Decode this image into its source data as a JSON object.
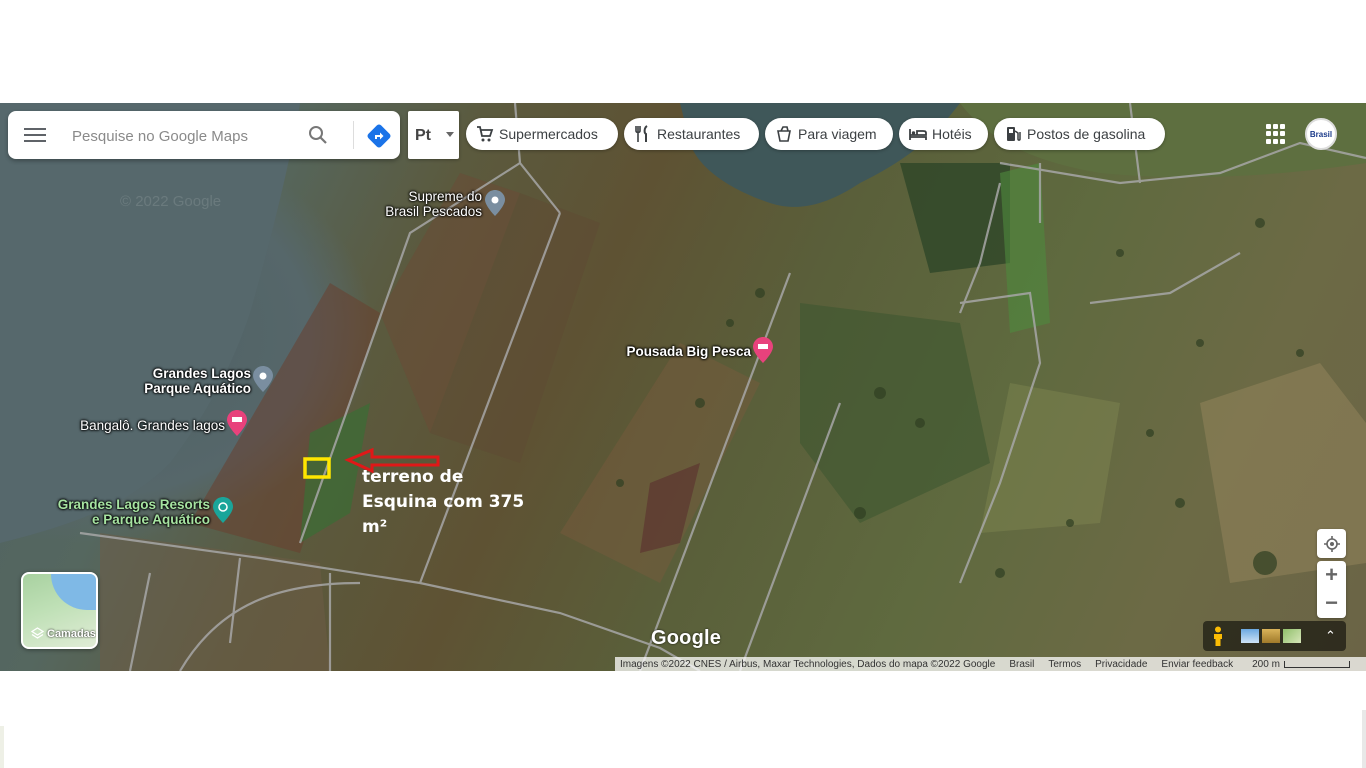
{
  "search": {
    "placeholder": "Pesquise no Google Maps",
    "menu_icon": "menu-icon",
    "search_icon": "search-icon",
    "directions_icon": "directions-icon"
  },
  "language": {
    "label": "Pt"
  },
  "chips": [
    {
      "label": "Supermercados",
      "icon": "cart-icon"
    },
    {
      "label": "Restaurantes",
      "icon": "fork-knife-icon"
    },
    {
      "label": "Para viagem",
      "icon": "takeout-icon"
    },
    {
      "label": "Hotéis",
      "icon": "bed-icon"
    },
    {
      "label": "Postos de gasolina",
      "icon": "fuel-icon"
    }
  ],
  "account": {
    "avatar_text": "Brasil"
  },
  "places": {
    "supreme": "Supreme do\nBrasil Pescados",
    "pousada": "Pousada Big Pesca",
    "grandes_lagos": "Grandes Lagos\nParque Aquático",
    "bangalo": "Bangalô. Grandes lagos",
    "resorts": "Grandes Lagos Resorts\ne Parque Aquático"
  },
  "annotation": {
    "text": "terreno de Esquina com 375 m²",
    "colors": {
      "arrow": "#e01818",
      "marker": "#ffe600"
    }
  },
  "watermark": "© 2022 Google",
  "layers": {
    "label": "Camadas"
  },
  "controls": {
    "zoom_in": "+",
    "zoom_out": "−",
    "expand": "⌃"
  },
  "logo": "Google",
  "footer": {
    "imagery": "Imagens ©2022 CNES / Airbus, Maxar Technologies, Dados do mapa ©2022 Google",
    "country": "Brasil",
    "terms": "Termos",
    "privacy": "Privacidade",
    "feedback": "Enviar feedback",
    "scale": "200 m"
  }
}
